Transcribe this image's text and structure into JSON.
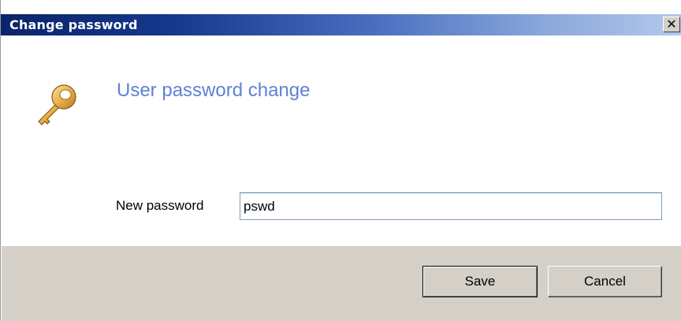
{
  "window": {
    "title": "Change password",
    "close_glyph": "✕"
  },
  "dialog": {
    "icon": "key-icon",
    "heading": "User password change",
    "heading_color": "#5e82d6",
    "new_password_label": "New password",
    "new_password_value": "pswd"
  },
  "buttons": {
    "save_label": "Save",
    "cancel_label": "Cancel"
  },
  "colors": {
    "title_gradient_start": "#0a246a",
    "title_gradient_end": "#b4c9ec",
    "button_face": "#d4d0c8"
  }
}
